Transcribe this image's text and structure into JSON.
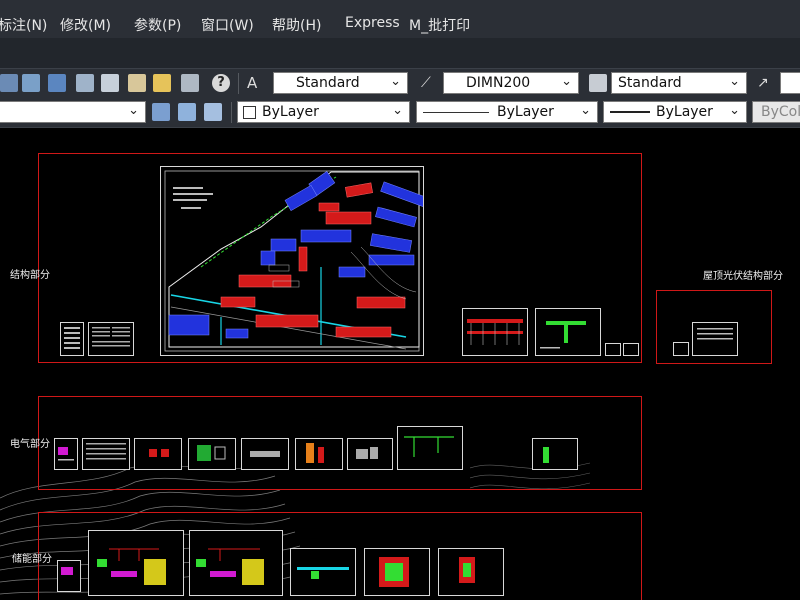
{
  "menu": [
    {
      "key": "annotate",
      "label": "标注(N)"
    },
    {
      "key": "modify",
      "label": "修改(M)"
    },
    {
      "key": "params",
      "label": "参数(P)"
    },
    {
      "key": "window",
      "label": "窗口(W)"
    },
    {
      "key": "help",
      "label": "帮助(H)"
    },
    {
      "key": "express",
      "label": "Express"
    },
    {
      "key": "batchplot",
      "label": "M_批打印"
    }
  ],
  "toolbar1": {
    "text_style": "Standard",
    "dim_style": "DIMN200",
    "table_style": "Standard"
  },
  "toolbar2": {
    "layer_value": "",
    "color": "ByLayer",
    "linetype": "ByLayer",
    "lineweight": "ByLayer",
    "plotstyle": "ByCol"
  },
  "drawing": {
    "section_structure": "结构部分",
    "section_rooftop_pv": "屋顶光伏结构部分",
    "section_electrical": "电气部分",
    "section_storage": "储能部分"
  },
  "colors": {
    "title_bar": "#2b2f36",
    "frame_red": "#d01818",
    "building_blue": "#2233dd",
    "building_red": "#d41a1a",
    "road_cyan": "#18d6e6"
  }
}
